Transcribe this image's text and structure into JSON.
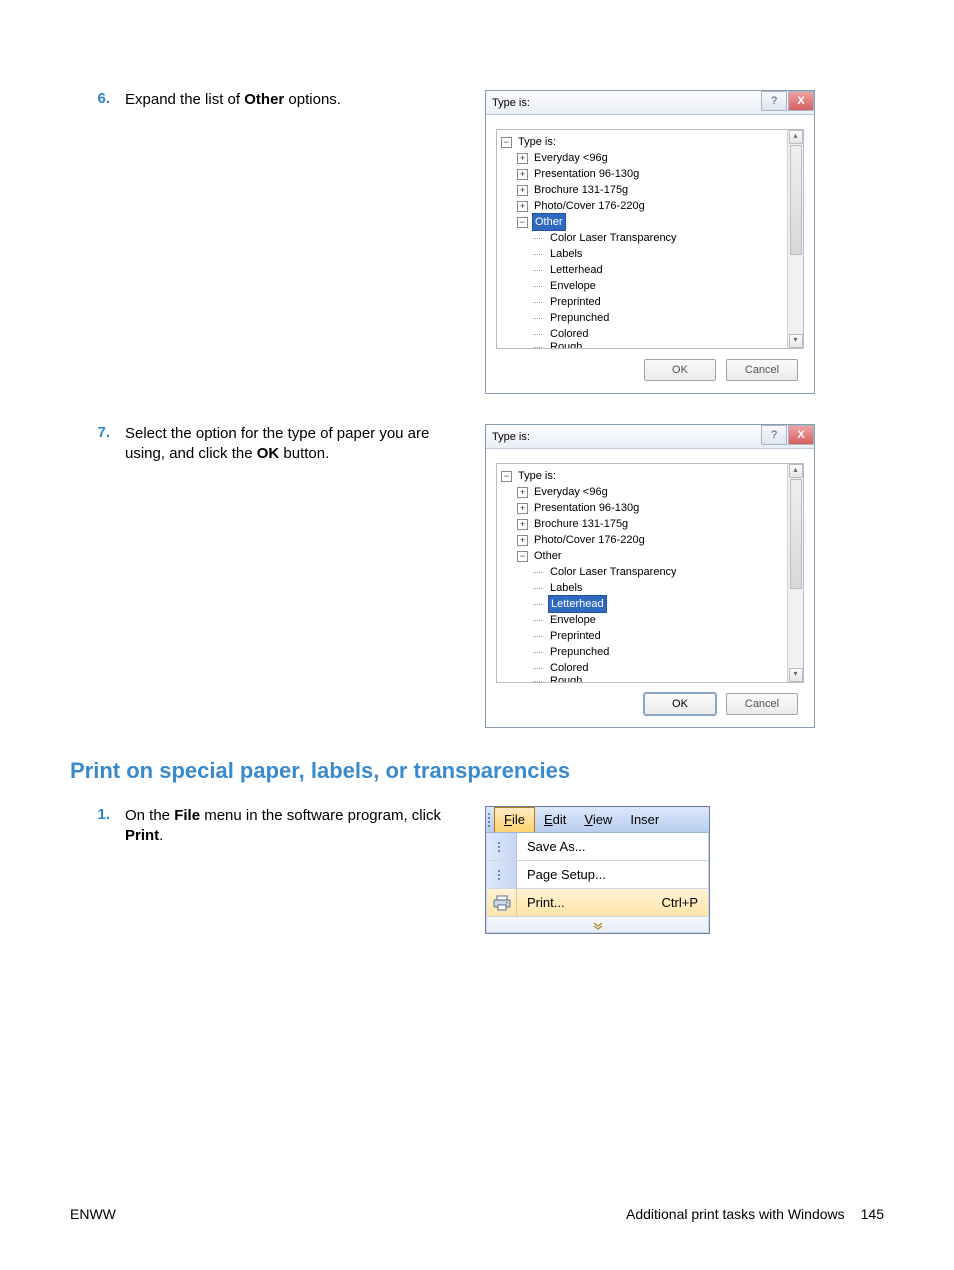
{
  "steps": {
    "s6": {
      "num": "6.",
      "text_a": "Expand the list of ",
      "bold_a": "Other",
      "text_b": " options."
    },
    "s7": {
      "num": "7.",
      "text_a": "Select the option for the type of paper you are using, and click the ",
      "bold_a": "OK",
      "text_b": " button."
    },
    "s1": {
      "num": "1.",
      "text_a": "On the ",
      "bold_a": "File",
      "text_b": " menu in the software program, click ",
      "bold_b": "Print",
      "text_c": "."
    }
  },
  "dialog": {
    "title": "Type is:",
    "tree_root": "Type is:",
    "items_l1": [
      "Everyday <96g",
      "Presentation 96-130g",
      "Brochure 131-175g",
      "Photo/Cover 176-220g"
    ],
    "other": "Other",
    "items_l2": [
      "Color Laser Transparency",
      "Labels",
      "Letterhead",
      "Envelope",
      "Preprinted",
      "Prepunched",
      "Colored",
      "Rough"
    ],
    "ok": "OK",
    "cancel": "Cancel"
  },
  "section_heading": "Print on special paper, labels, or transparencies",
  "filemenu": {
    "file": "File",
    "edit": "Edit",
    "view": "View",
    "insert": "Inser",
    "save_as": "Save As...",
    "page_setup": "Page Setup...",
    "print": "Print...",
    "print_kbd": "Ctrl+P"
  },
  "footer": {
    "left": "ENWW",
    "right": "Additional print tasks with Windows",
    "page": "145"
  }
}
